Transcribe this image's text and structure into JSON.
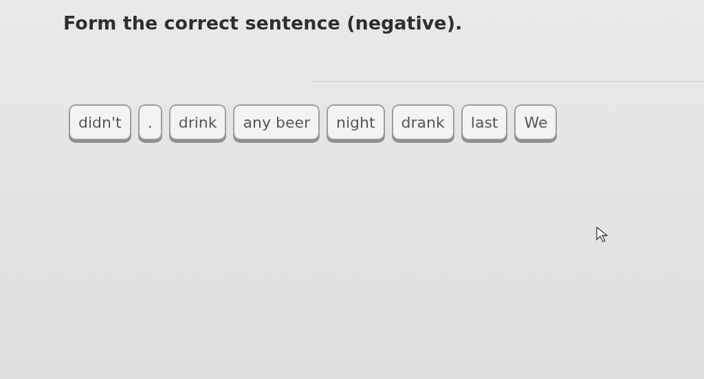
{
  "instruction": "Form the correct sentence (negative).",
  "words": [
    {
      "text": "didn't"
    },
    {
      "text": "."
    },
    {
      "text": "drink"
    },
    {
      "text": "any beer"
    },
    {
      "text": "night"
    },
    {
      "text": "drank"
    },
    {
      "text": "last"
    },
    {
      "text": "We"
    }
  ]
}
